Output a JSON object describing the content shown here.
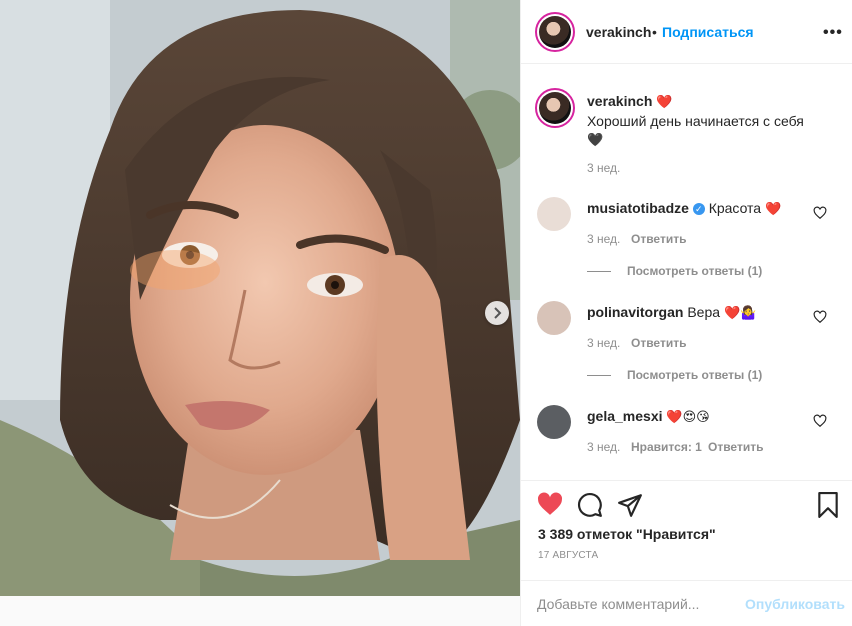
{
  "header": {
    "username": "verakinch",
    "dot": "•",
    "follow_label": "Подписаться",
    "more": "•••"
  },
  "caption": {
    "username": "verakinch",
    "user_emoji": "❤️",
    "text": "Хороший день начинается с себя",
    "text_emoji": "🖤",
    "time": "3 нед."
  },
  "comments": [
    {
      "username": "musiatotibadze",
      "verified": true,
      "text": "Красота",
      "emoji": "❤️",
      "time": "3 нед.",
      "likes": "",
      "reply_label": "Ответить",
      "view_replies": "Посмотреть ответы (1)"
    },
    {
      "username": "polinavitorgan",
      "verified": false,
      "text": "Вера",
      "emoji": "❤️🤷‍♀️",
      "time": "3 нед.",
      "likes": "",
      "reply_label": "Ответить",
      "view_replies": "Посмотреть ответы (1)"
    },
    {
      "username": "gela_mesxi",
      "verified": false,
      "text": "",
      "emoji": "❤️😍😘",
      "time": "3 нед.",
      "likes": "Нравится: 1",
      "reply_label": "Ответить",
      "view_replies": ""
    }
  ],
  "likes_text": "3 389 отметок \"Нравится\"",
  "date": "17 АВГУСТА",
  "add_comment": {
    "placeholder": "Добавьте комментарий...",
    "publish_label": "Опубликовать"
  },
  "colors": {
    "link": "#0095f6",
    "like": "#ed4956",
    "muted": "#8e8e8e",
    "publish_disabled": "#b2dffc"
  },
  "icons": {
    "like": "heart-filled-icon",
    "comment": "comment-bubble-icon",
    "share": "paper-plane-icon",
    "save": "bookmark-icon",
    "next": "chevron-right-icon",
    "comment_like": "heart-outline-icon"
  }
}
